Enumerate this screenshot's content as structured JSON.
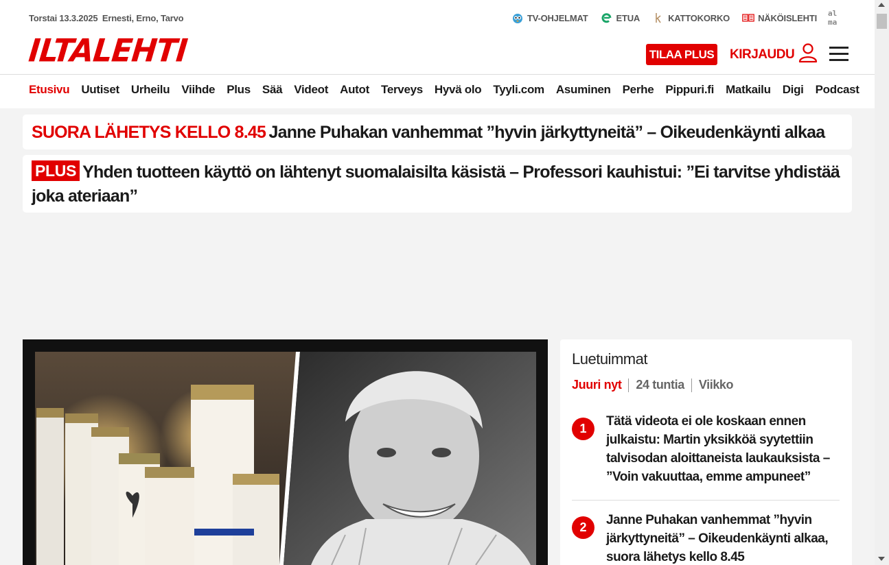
{
  "topbar": {
    "date": "Torstai 13.3.2025",
    "name_days": "Ernesti, Erno, Tarvo",
    "links": [
      {
        "label": "TV-OHJELMAT",
        "icon": "tv-owl-icon"
      },
      {
        "label": "ETUA",
        "icon": "etua-icon"
      },
      {
        "label": "KATTOKORKO",
        "icon": "kattokorko-icon"
      },
      {
        "label": "NÄKÖISLEHTI",
        "icon": "newspaper-icon"
      }
    ],
    "alma_logo": "alma"
  },
  "header": {
    "logo": "ILTALEHTI",
    "subscribe_label": "TILAA PLUS",
    "login_label": "KIRJAUDU"
  },
  "nav": {
    "items": [
      "Etusivu",
      "Uutiset",
      "Urheilu",
      "Viihde",
      "Plus",
      "Sää",
      "Videot",
      "Autot",
      "Terveys",
      "Hyvä olo",
      "Tyyli.com",
      "Asuminen",
      "Perhe",
      "Pippuri.fi",
      "Matkailu",
      "Digi",
      "Podcast"
    ],
    "active": "Etusivu"
  },
  "headlines": {
    "live_tag": "SUORA LÄHETYS KELLO 8.45",
    "live_title": "Janne Puhakan vanhemmat ”hyvin järkyttyneitä” – Oikeudenkäynti alkaa",
    "plus_tag": "PLUS",
    "plus_title": "Yhden tuotteen käyttö on lähtenyt suomalaisilta käsistä – Professori kauhistui: ”Ei tarvitse yhdistää joka ateriaan”"
  },
  "most_read": {
    "title": "Luetuimmat",
    "tabs": [
      "Juuri nyt",
      "24 tuntia",
      "Viikko"
    ],
    "active_tab": "Juuri nyt",
    "items": [
      {
        "rank": "1",
        "title": "Tätä videota ei ole koskaan ennen julkaistu: Martin yksikköä syytettiin talvisodan aloittaneista laukauksista – ”Voin vakuuttaa, emme ampuneet”"
      },
      {
        "rank": "2",
        "title": "Janne Puhakan vanhemmat ”hyvin järkyttyneitä” – Oikeudenkäynti alkaa, suora lähetys kello 8.45"
      }
    ]
  },
  "colors": {
    "brand_red": "#e10000",
    "text": "#1a1a1a",
    "background": "#f3f3f3"
  }
}
